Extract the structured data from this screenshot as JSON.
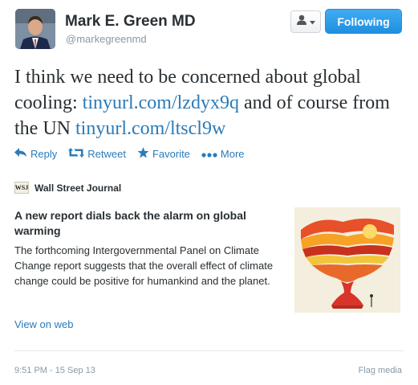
{
  "author": {
    "name": "Mark E. Green MD",
    "handle": "@markegreenmd"
  },
  "follow_button": {
    "label": "Following",
    "color": "#2a9cea"
  },
  "tweet": {
    "text_1": "I think we need to be concerned about global cooling: ",
    "link_1": "tinyurl.com/lzdyx9q",
    "text_2": "  and of course from the UN ",
    "link_2": "tinyurl.com/ltscl9w"
  },
  "actions": {
    "reply": "Reply",
    "retweet": "Retweet",
    "favorite": "Favorite",
    "more": "More"
  },
  "card": {
    "source_logo": "WSJ",
    "source": "Wall Street Journal",
    "title": "A new report dials back the alarm on global warming",
    "description": "The forthcoming Intergovernmental Panel on Climate Change report suggests that the overall effect of climate change could be positive for humankind and the planet.",
    "view_link": "View on web"
  },
  "footer": {
    "timestamp": "9:51 PM - 15 Sep 13",
    "flag": "Flag media"
  },
  "colors": {
    "link": "#2b7bb9",
    "muted": "#8899a6"
  }
}
